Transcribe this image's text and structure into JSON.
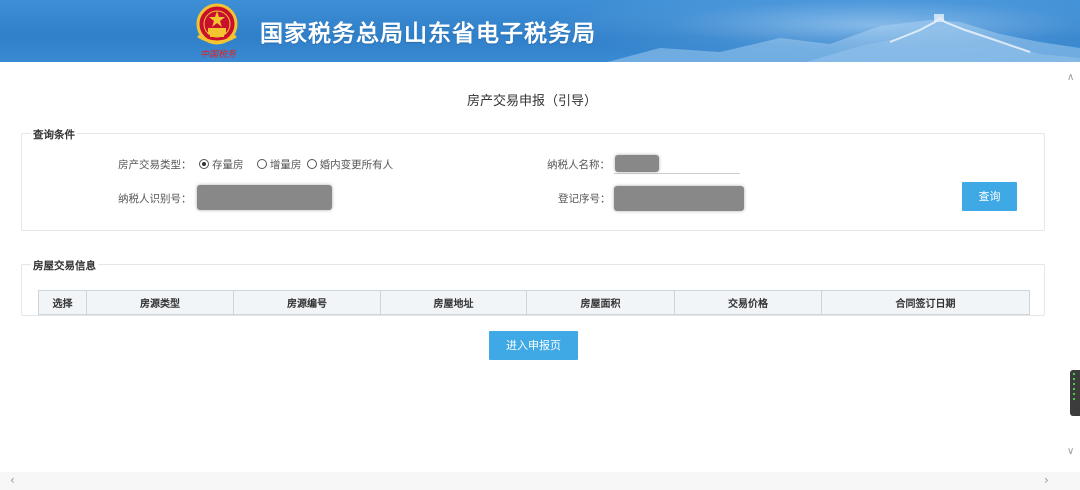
{
  "header": {
    "title": "国家税务总局山东省电子税务局",
    "emblem_caption": "中国税务"
  },
  "page": {
    "title": "房产交易申报（引导）"
  },
  "query": {
    "legend": "查询条件",
    "type_label": "房产交易类型：",
    "type_options": [
      {
        "label": "存量房",
        "checked": true
      },
      {
        "label": "增量房",
        "checked": false
      },
      {
        "label": "婚内变更所有人",
        "checked": false
      }
    ],
    "taxpayer_name_label": "纳税人名称：",
    "taxpayer_id_label": "纳税人识别号：",
    "register_no_label": "登记序号：",
    "search_button": "查询"
  },
  "house": {
    "legend": "房屋交易信息",
    "columns": [
      "选择",
      "房源类型",
      "房源编号",
      "房屋地址",
      "房屋面积",
      "交易价格",
      "合同签订日期"
    ]
  },
  "actions": {
    "submit_button": "进入申报页"
  },
  "colors": {
    "header_blue": "#2f7fc9",
    "button_blue": "#3fa9e6"
  },
  "icons": {
    "emblem": "national-emblem-icon",
    "scroll_up": "chevron-up-icon",
    "scroll_down": "chevron-down-icon",
    "scroll_left": "chevron-left-icon",
    "scroll_right": "chevron-right-icon"
  }
}
